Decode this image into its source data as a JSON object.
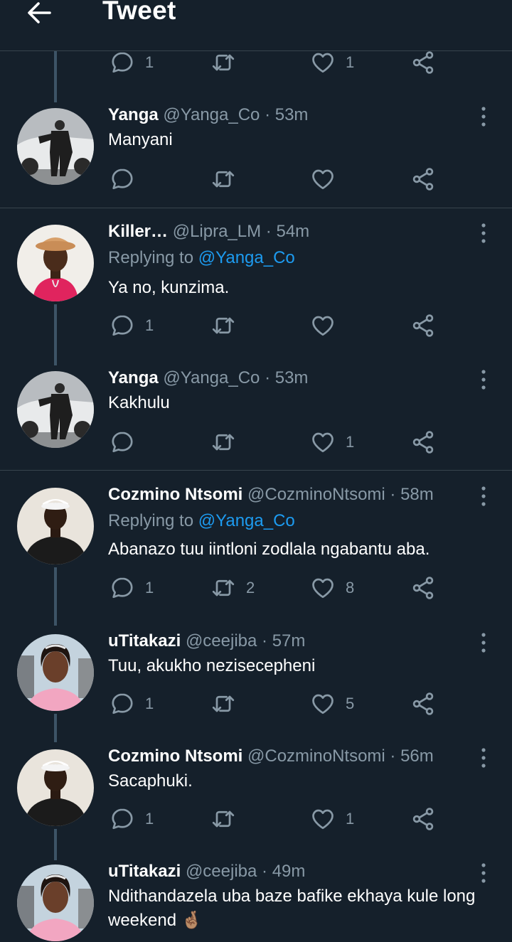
{
  "header": {
    "title": "Tweet"
  },
  "top_actions": {
    "reply_count": "1",
    "retweet_count": "",
    "like_count": "1"
  },
  "tweets": [
    {
      "name": "Yanga",
      "handle": "@Yanga_Co",
      "sep": "·",
      "time": "53m",
      "reply_label": "",
      "reply_handle": "",
      "text": "Manyani",
      "reply_count": "",
      "retweet_count": "",
      "like_count": ""
    },
    {
      "name": "Killer…",
      "handle": "@Lipra_LM",
      "sep": "·",
      "time": "54m",
      "reply_label": "Replying to ",
      "reply_handle": "@Yanga_Co",
      "text": "Ya no, kunzima.",
      "reply_count": "1",
      "retweet_count": "",
      "like_count": ""
    },
    {
      "name": "Yanga",
      "handle": "@Yanga_Co",
      "sep": "·",
      "time": "53m",
      "reply_label": "",
      "reply_handle": "",
      "text": "Kakhulu",
      "reply_count": "",
      "retweet_count": "",
      "like_count": "1"
    },
    {
      "name": "Cozmino Ntsomi",
      "handle": "@CozminoNtsomi",
      "sep": "·",
      "time": "58m",
      "reply_label": "Replying to ",
      "reply_handle": "@Yanga_Co",
      "text": "Abanazo tuu iintloni zodlala ngabantu aba.",
      "reply_count": "1",
      "retweet_count": "2",
      "like_count": "8"
    },
    {
      "name": "uTitakazi",
      "handle": "@ceejiba",
      "sep": "·",
      "time": "57m",
      "reply_label": "",
      "reply_handle": "",
      "text": "Tuu, akukho nezisecepheni",
      "reply_count": "1",
      "retweet_count": "",
      "like_count": "5"
    },
    {
      "name": "Cozmino Ntsomi",
      "handle": "@CozminoNtsomi",
      "sep": "·",
      "time": "56m",
      "reply_label": "",
      "reply_handle": "",
      "text": "Sacaphuki.",
      "reply_count": "1",
      "retweet_count": "",
      "like_count": "1"
    },
    {
      "name": "uTitakazi",
      "handle": "@ceejiba",
      "sep": "·",
      "time": "49m",
      "reply_label": "",
      "reply_handle": "",
      "text": "Ndithandazela uba baze bafike ekhaya kule long weekend 🤞🏽",
      "reply_count": "",
      "retweet_count": "",
      "like_count": ""
    }
  ],
  "colors": {
    "background": "#15202b",
    "divider": "#38444d",
    "muted": "#8899a6",
    "link": "#1d9bf0",
    "thread": "#3d5466"
  },
  "icons": [
    "back-arrow-icon",
    "reply-icon",
    "retweet-icon",
    "like-icon",
    "share-icon",
    "more-options-icon"
  ]
}
